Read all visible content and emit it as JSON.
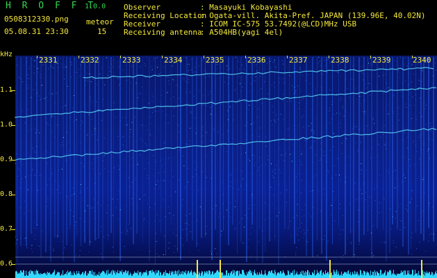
{
  "header": {
    "app_title": "H R O F F T",
    "app_version": "1.0.0",
    "filename": "0508312330.png",
    "meteor_label": "meteor",
    "datetime": "05.08.31 23:30",
    "meteor_count": "15",
    "info": [
      {
        "label": "Observer",
        "value": ": Masayuki Kobayashi"
      },
      {
        "label": "Receiving Location",
        "value": ": Ogata-vill. Akita-Pref. JAPAN (139.96E, 40.02N)"
      },
      {
        "label": "Receiver",
        "value": ": ICOM IC-575 53.7492(@LCD)MHz USB"
      },
      {
        "label": "Receiving antenna",
        "value": ": A504HB(yagi 4el)"
      }
    ]
  },
  "spectrogram": {
    "y_unit": "kHz",
    "y_ticks": [
      "1.1",
      "1.0",
      "0.9",
      "0.8",
      "0.7",
      "0.6"
    ],
    "x_ticks": [
      "2331",
      "2332",
      "2333",
      "2334",
      "2335",
      "2336",
      "2337",
      "2338",
      "2339",
      "2340"
    ],
    "colors": {
      "background": "#0a1f86",
      "noise": "#2e6cff",
      "signal": "#5fe6ff",
      "labels": "#f5e93c"
    }
  }
}
